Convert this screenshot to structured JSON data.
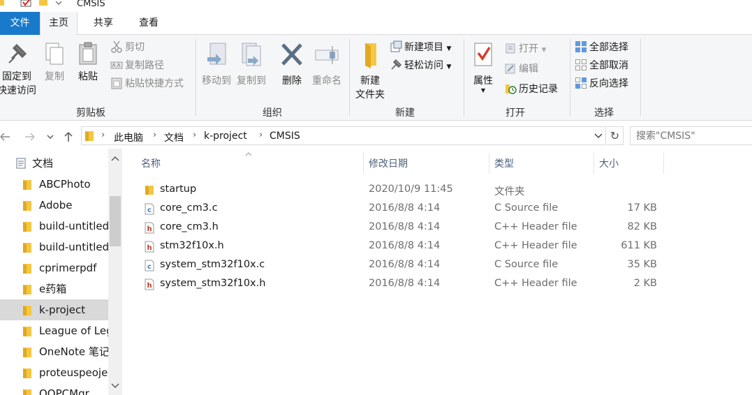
{
  "window": {
    "title": "CMSIS"
  },
  "tabs": {
    "file": "文件",
    "home": "主页",
    "share": "共享",
    "view": "查看"
  },
  "ribbon": {
    "clipboard": {
      "label": "剪贴板",
      "pin_line1": "固定到",
      "pin_line2": "快速访问",
      "copy": "复制",
      "paste": "粘贴",
      "cut": "剪切",
      "copy_path": "复制路径",
      "paste_shortcut": "粘贴快捷方式"
    },
    "organize": {
      "label": "组织",
      "move_to": "移动到",
      "copy_to": "复制到",
      "delete": "删除",
      "rename": "重命名"
    },
    "new": {
      "label": "新建",
      "new_folder_line1": "新建",
      "new_folder_line2": "文件夹",
      "new_item": "新建项目",
      "easy_access": "轻松访问"
    },
    "open": {
      "label": "打开",
      "properties": "属性",
      "open": "打开",
      "edit": "编辑",
      "history": "历史记录"
    },
    "select": {
      "label": "选择",
      "select_all": "全部选择",
      "select_none": "全部取消",
      "invert": "反向选择"
    }
  },
  "address": {
    "crumbs": [
      "此电脑",
      "文档",
      "k-project",
      "CMSIS"
    ],
    "search_placeholder": "搜索\"CMSIS\""
  },
  "nav": {
    "header": "文档",
    "items": [
      {
        "label": "ABCPhoto"
      },
      {
        "label": "Adobe"
      },
      {
        "label": "build-untitled"
      },
      {
        "label": "build-untitled"
      },
      {
        "label": "cprimerpdf"
      },
      {
        "label": "e药箱"
      },
      {
        "label": "k-project",
        "selected": true
      },
      {
        "label": "League of Leg"
      },
      {
        "label": "OneNote 笔记"
      },
      {
        "label": "proteuspeoje"
      },
      {
        "label": "QQPCMgr"
      }
    ]
  },
  "columns": {
    "name": "名称",
    "date": "修改日期",
    "type": "类型",
    "size": "大小"
  },
  "files": [
    {
      "name": "startup",
      "date": "2020/10/9 11:45",
      "type": "文件夹",
      "size": "",
      "kind": "folder"
    },
    {
      "name": "core_cm3.c",
      "date": "2016/8/8 4:14",
      "type": "C Source file",
      "size": "17 KB",
      "kind": "c"
    },
    {
      "name": "core_cm3.h",
      "date": "2016/8/8 4:14",
      "type": "C++ Header file",
      "size": "82 KB",
      "kind": "h"
    },
    {
      "name": "stm32f10x.h",
      "date": "2016/8/8 4:14",
      "type": "C++ Header file",
      "size": "611 KB",
      "kind": "h"
    },
    {
      "name": "system_stm32f10x.c",
      "date": "2016/8/8 4:14",
      "type": "C Source file",
      "size": "35 KB",
      "kind": "c"
    },
    {
      "name": "system_stm32f10x.h",
      "date": "2016/8/8 4:14",
      "type": "C++ Header file",
      "size": "2 KB",
      "kind": "h"
    }
  ],
  "colors": {
    "accent": "#1979ca",
    "folder": "#f4c743",
    "selected": "#d9d9d9"
  }
}
